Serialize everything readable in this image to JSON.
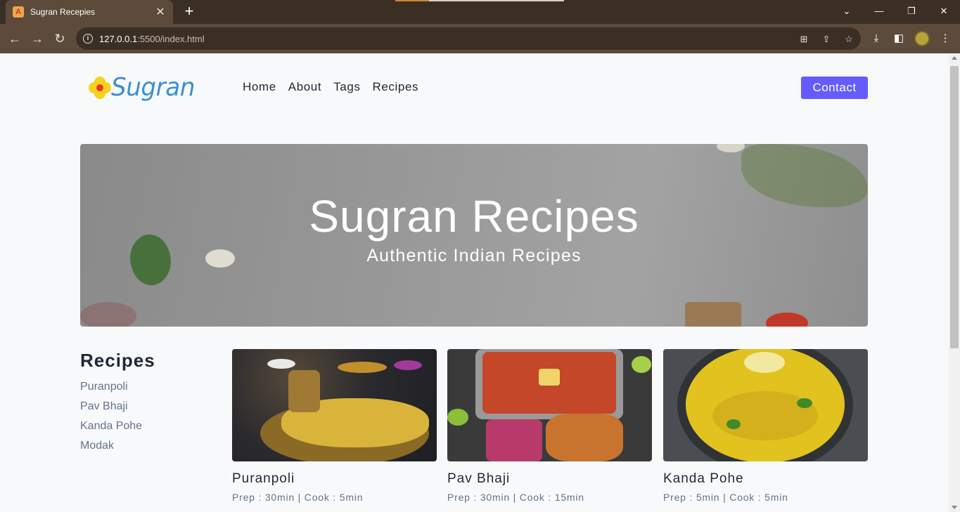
{
  "browser": {
    "tab_title": "Sugran Recepies",
    "url_host": "127.0.0.1",
    "url_rest": ":5500/index.html"
  },
  "site": {
    "logo_text": "Sugran",
    "nav": [
      "Home",
      "About",
      "Tags",
      "Recipes"
    ],
    "contact_label": "Contact",
    "hero": {
      "title": "Sugran Recipes",
      "subtitle": "Authentic Indian Recipes"
    },
    "sidebar": {
      "title": "Recipes",
      "items": [
        "Puranpoli",
        "Pav Bhaji",
        "Kanda Pohe",
        "Modak"
      ]
    },
    "cards": [
      {
        "name": "Puranpoli",
        "meta": "Prep : 30min | Cook : 5min"
      },
      {
        "name": "Pav Bhaji",
        "meta": "Prep : 30min | Cook : 15min"
      },
      {
        "name": "Kanda Pohe",
        "meta": "Prep : 5min | Cook : 5min"
      }
    ]
  },
  "colors": {
    "accent": "#645cff",
    "logo_blue": "#3d8fd4",
    "chrome_dark": "#3b2f25",
    "chrome_mid": "#5c4a3a"
  }
}
